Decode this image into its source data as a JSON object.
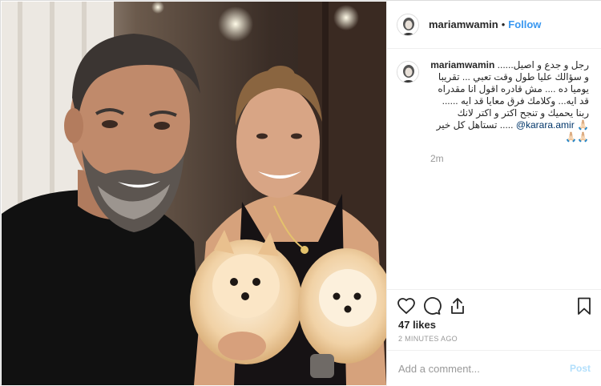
{
  "post": {
    "username": "mariamwamin",
    "separator": "•",
    "follow_label": "Follow",
    "photo_alt": ""
  },
  "caption": {
    "username": "mariamwamin",
    "text": "رجل و جدع و اصيل...... و سؤالك عليا طول وقت تعبي ... تقريبا يوميا ده .... مش قادره اقول انا مقدراه قد ايه... وكلامك فرق معايا قد ايه ...... ربنا يحميك و تنجح اكتر و اكتر لانك تستاهل كل خير .....",
    "mention": "@karara.amir",
    "emojis": "🙏🏻🙏🏻🙏🏻",
    "time": "2m"
  },
  "actions": {
    "like_icon": "heart-icon",
    "comment_icon": "comment-icon",
    "share_icon": "share-icon",
    "save_icon": "bookmark-icon"
  },
  "likes_label": "47 likes",
  "posted_label": "2 MINUTES AGO",
  "add_comment": {
    "placeholder": "Add a comment...",
    "post_label": "Post"
  },
  "colors": {
    "link": "#3897f0",
    "post_disabled": "#b2dffc",
    "border": "#efefef"
  }
}
